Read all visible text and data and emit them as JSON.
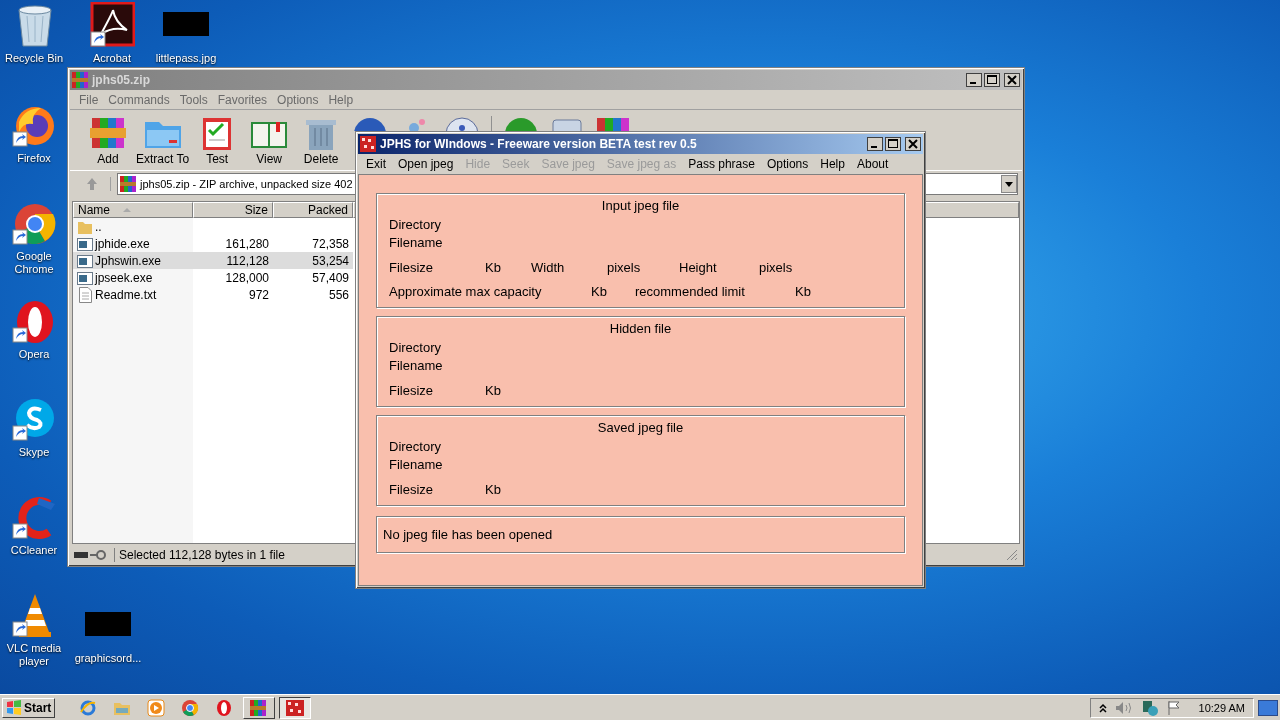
{
  "desktop_icons": [
    {
      "label": "Recycle Bin",
      "kind": "recycle"
    },
    {
      "label": "Acrobat",
      "kind": "acrobat"
    },
    {
      "label": "littlepass.jpg",
      "kind": "redacted"
    },
    {
      "label": "Firefox",
      "kind": "firefox"
    },
    {
      "label": "Google Chrome",
      "kind": "chrome"
    },
    {
      "label": "Opera",
      "kind": "opera"
    },
    {
      "label": "Skype",
      "kind": "skype"
    },
    {
      "label": "CCleaner",
      "kind": "ccleaner"
    },
    {
      "label": "VLC media player",
      "kind": "vlc"
    },
    {
      "label": "graphicsord...",
      "kind": "redacted"
    }
  ],
  "archive_window": {
    "title": "jphs05.zip",
    "menu": [
      "File",
      "Commands",
      "Tools",
      "Favorites",
      "Options",
      "Help"
    ],
    "toolbar": [
      {
        "label": "Add",
        "kind": "add"
      },
      {
        "label": "Extract To",
        "kind": "extract"
      },
      {
        "label": "Test",
        "kind": "test"
      },
      {
        "label": "View",
        "kind": "view"
      },
      {
        "label": "Delete",
        "kind": "delete"
      },
      {
        "kind": "find"
      },
      {
        "kind": "wizard"
      },
      {
        "kind": "info"
      },
      {
        "kind": "virus"
      },
      {
        "kind": "comment"
      },
      {
        "kind": "sfx"
      }
    ],
    "path": "jphs05.zip - ZIP archive, unpacked size 402",
    "columns": [
      "Name",
      "Size",
      "Packed"
    ],
    "rows": [
      {
        "name": "..",
        "size": "",
        "packed": "",
        "kind": "folder",
        "selected": false
      },
      {
        "name": "jphide.exe",
        "size": "161,280",
        "packed": "72,358",
        "kind": "exe",
        "selected": false
      },
      {
        "name": "Jphswin.exe",
        "size": "112,128",
        "packed": "53,254",
        "kind": "exe",
        "selected": true
      },
      {
        "name": "jpseek.exe",
        "size": "128,000",
        "packed": "57,409",
        "kind": "exe",
        "selected": false
      },
      {
        "name": "Readme.txt",
        "size": "972",
        "packed": "556",
        "kind": "txt",
        "selected": false
      }
    ],
    "status": "Selected 112,128 bytes in 1 file"
  },
  "jphs_window": {
    "title": "JPHS for WIndows - Freeware version BETA test rev 0.5",
    "menu": [
      {
        "label": "Exit",
        "disabled": false
      },
      {
        "label": "Open jpeg",
        "disabled": false
      },
      {
        "label": "Hide",
        "disabled": true
      },
      {
        "label": "Seek",
        "disabled": true
      },
      {
        "label": "Save jpeg",
        "disabled": true
      },
      {
        "label": "Save jpeg as",
        "disabled": true
      },
      {
        "label": "Pass phrase",
        "disabled": false
      },
      {
        "label": "Options",
        "disabled": false
      },
      {
        "label": "Help",
        "disabled": false
      },
      {
        "label": "About",
        "disabled": false
      }
    ],
    "sections": [
      {
        "title": "Input jpeg file",
        "lines": [
          {
            "kind": "name",
            "texts": [
              "Directory"
            ]
          },
          {
            "kind": "name",
            "texts": [
              "Filename"
            ]
          },
          {
            "kind": "size",
            "texts": [
              "Filesize",
              "Kb",
              "Width",
              "pixels",
              "Height",
              "pixels"
            ]
          },
          {
            "kind": "capacity",
            "texts": [
              "Approximate max capacity",
              "Kb",
              "recommended limit",
              "Kb"
            ]
          }
        ]
      },
      {
        "title": "Hidden file",
        "lines": [
          {
            "kind": "name",
            "texts": [
              "Directory"
            ]
          },
          {
            "kind": "name",
            "texts": [
              "Filename"
            ]
          },
          {
            "kind": "size",
            "texts": [
              "Filesize",
              "Kb"
            ]
          }
        ]
      },
      {
        "title": "Saved jpeg file",
        "lines": [
          {
            "kind": "name",
            "texts": [
              "Directory"
            ]
          },
          {
            "kind": "name",
            "texts": [
              "Filename"
            ]
          },
          {
            "kind": "size",
            "texts": [
              "Filesize",
              "Kb"
            ]
          }
        ]
      }
    ],
    "status": "No jpeg file has been opened"
  },
  "taskbar": {
    "start": "Start",
    "pinned": [
      {
        "kind": "ie"
      },
      {
        "kind": "explorer"
      },
      {
        "kind": "media"
      },
      {
        "kind": "chrome"
      },
      {
        "kind": "opera"
      }
    ],
    "tasks": [
      {
        "kind": "winrar",
        "selected": false
      },
      {
        "kind": "jphs",
        "selected": true
      }
    ],
    "clock": "10:29 AM"
  }
}
